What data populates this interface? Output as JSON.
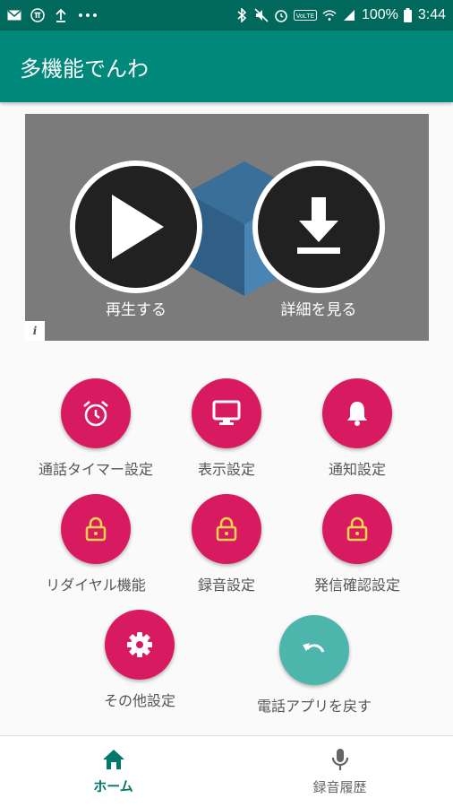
{
  "status_bar": {
    "battery": "100%",
    "time": "3:44",
    "lte": "VoLTE",
    "left_icons": [
      "mail-icon",
      "pi-icon",
      "upload-icon",
      "more-icon"
    ],
    "right_icons": [
      "bluetooth-icon",
      "mute-icon",
      "alarm-icon",
      "volte-icon",
      "wifi-icon",
      "signal-icon",
      "battery-icon"
    ]
  },
  "app_bar": {
    "title": "多機能でんわ"
  },
  "ad_banner": {
    "play_label": "再生する",
    "details_label": "詳細を見る",
    "info_badge": "i"
  },
  "menu": {
    "call_timer": "通話タイマー設定",
    "display": "表示設定",
    "notification": "通知設定",
    "redial": "リダイヤル機能",
    "recording": "録音設定",
    "outgoing_confirm": "発信確認設定",
    "other": "その他設定",
    "return_phone": "電話アプリを戻す"
  },
  "bottom_nav": {
    "home": "ホーム",
    "recording_history": "録音履歴"
  },
  "colors": {
    "status_bar": "#00695c",
    "app_bar": "#00897b",
    "accent_pink": "#d81b60",
    "accent_teal": "#4db6ac",
    "lock_yellow": "#ffd54f",
    "active_nav": "#00796b"
  }
}
